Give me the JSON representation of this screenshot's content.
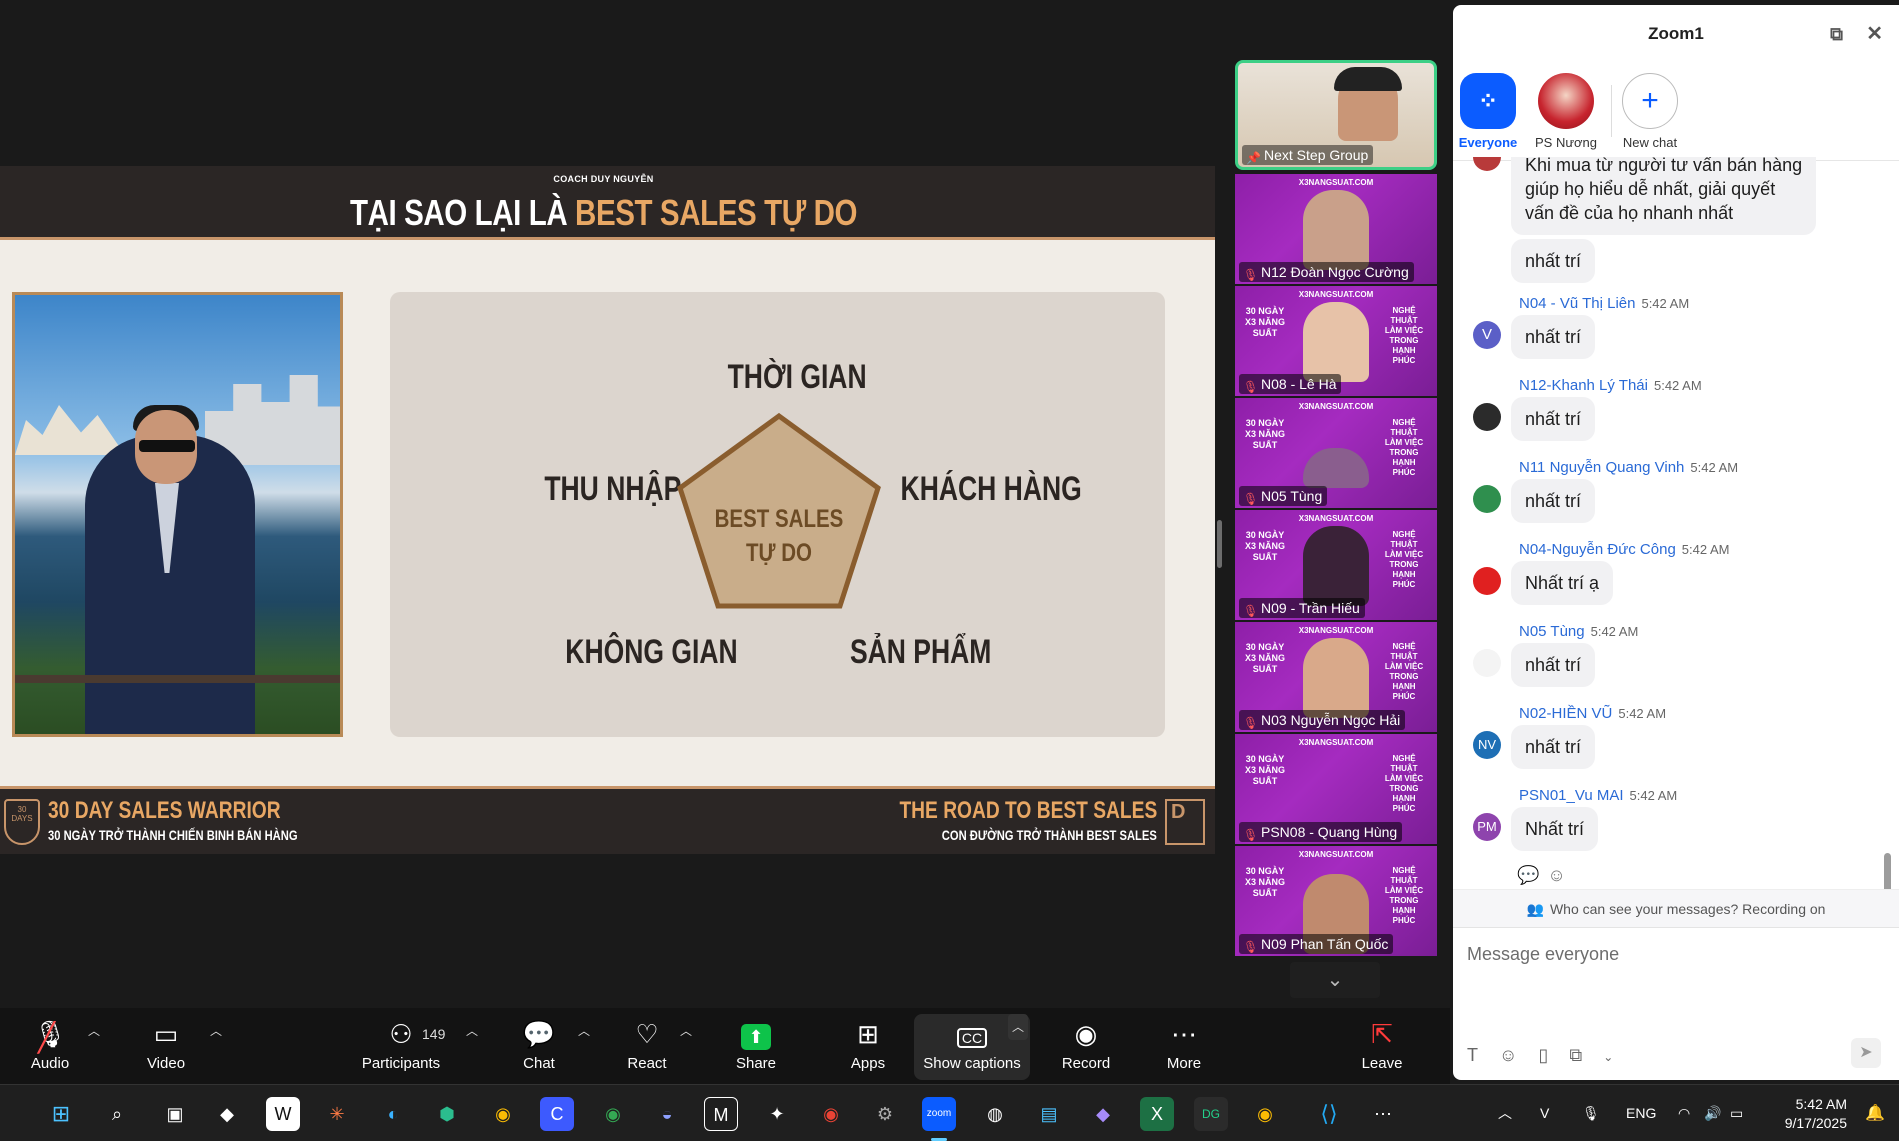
{
  "slide": {
    "coach": "COACH DUY NGUYỄN",
    "title_pre": "TẠI SAO LẠI LÀ ",
    "title_hl": "BEST SALES TỰ DO",
    "center_line1": "BEST SALES",
    "center_line2": "TỰ DO",
    "keywords": {
      "top": "THỜI GIAN",
      "left": "THU NHẬP",
      "right": "KHÁCH HÀNG",
      "bottom_left": "KHÔNG GIAN",
      "bottom_right": "SẢN PHẨM"
    },
    "footer_left_1": "30 DAY SALES WARRIOR",
    "footer_left_2": "30 NGÀY TRỞ THÀNH CHIẾN BINH BÁN HÀNG",
    "footer_right_1": "THE ROAD TO BEST SALES",
    "footer_right_2": "CON ĐƯỜNG TRỞ THÀNH BEST SALES",
    "shield_text": "30 DAYS",
    "d_logo": "D"
  },
  "gallery": {
    "tile_url": "X3NANGSUAT.COM",
    "banner_left": "30 NGÀY X3 NĂNG SUẤT",
    "banner_right": "NGHỆ THUẬT LÀM VIỆC TRONG HẠNH PHÚC",
    "tiles": [
      {
        "name": "Next Step Group"
      },
      {
        "name": "N12 Đoàn Ngọc Cường"
      },
      {
        "name": "N08 - Lê Hà"
      },
      {
        "name": "N05 Tùng"
      },
      {
        "name": "N09 - Trần Hiếu"
      },
      {
        "name": "N03 Nguyễn Ngọc Hải"
      },
      {
        "name": "PSN08 - Quang Hùng"
      },
      {
        "name": "N09 Phan Tấn Quốc"
      }
    ]
  },
  "chat": {
    "title": "Zoom1",
    "tabs": [
      {
        "label": "Everyone"
      },
      {
        "label": "PS Nương ..."
      },
      {
        "label": "New chat"
      }
    ],
    "partial_message": "Khi mua từ người tư vấn bán hàng\ngiúp họ hiểu dễ nhất, giải quyết\nvấn đề của họ nhanh nhất",
    "partial_reply": "nhất trí",
    "messages": [
      {
        "sender": "N04 - Vũ Thị Liên",
        "time": "5:42 AM",
        "text": "nhất trí",
        "initials": "V",
        "color": "#5b5fc7"
      },
      {
        "sender": "N12-Khanh Lý Thái",
        "time": "5:42 AM",
        "text": "nhất trí",
        "initials": "",
        "color": "#2b2b2b"
      },
      {
        "sender": "N11 Nguyễn Quang Vinh",
        "time": "5:42 AM",
        "text": "nhất trí",
        "initials": "",
        "color": "#2f8f4e"
      },
      {
        "sender": "N04-Nguyễn Đức Công",
        "time": "5:42 AM",
        "text": "Nhất trí ạ",
        "initials": "",
        "color": "#e02020"
      },
      {
        "sender": "N05 Tùng",
        "time": "5:42 AM",
        "text": "nhất trí",
        "initials": "",
        "color": "#f2f2f2"
      },
      {
        "sender": "N02-HIỀN VŨ",
        "time": "5:42 AM",
        "text": "nhất trí",
        "initials": "NV",
        "color": "#1e6fb5"
      },
      {
        "sender": "PSN01_Vu MAI",
        "time": "5:42 AM",
        "text": "Nhất trí",
        "initials": "PM",
        "color": "#8e44ad"
      }
    ],
    "visibility_note": "Who can see your messages? Recording on",
    "compose_placeholder": "Message everyone"
  },
  "toolbar": {
    "audio": "Audio",
    "video": "Video",
    "participants": "Participants",
    "participant_count": "149",
    "chat": "Chat",
    "react": "React",
    "share": "Share",
    "apps": "Apps",
    "captions": "Show captions",
    "record": "Record",
    "more": "More",
    "leave": "Leave"
  },
  "taskbar": {
    "language": "ENG",
    "time": "5:42 AM",
    "date": "9/17/2025"
  }
}
